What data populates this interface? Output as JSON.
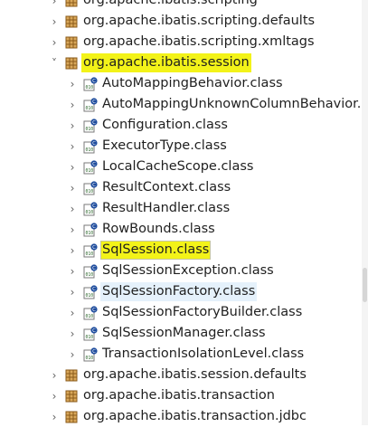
{
  "packages_before": [
    {
      "label": "org.apache.ibatis.scripting"
    },
    {
      "label": "org.apache.ibatis.scripting.defaults"
    },
    {
      "label": "org.apache.ibatis.scripting.xmltags"
    }
  ],
  "expanded_package": {
    "label": "org.apache.ibatis.session",
    "expander": "˅"
  },
  "classes": [
    {
      "label": "AutoMappingBehavior.class"
    },
    {
      "label": "AutoMappingUnknownColumnBehavior.cl"
    },
    {
      "label": "Configuration.class"
    },
    {
      "label": "ExecutorType.class"
    },
    {
      "label": "LocalCacheScope.class"
    },
    {
      "label": "ResultContext.class"
    },
    {
      "label": "ResultHandler.class"
    },
    {
      "label": "RowBounds.class"
    },
    {
      "label": "SqlSession.class"
    },
    {
      "label": "SqlSessionException.class"
    },
    {
      "label": "SqlSessionFactory.class"
    },
    {
      "label": "SqlSessionFactoryBuilder.class"
    },
    {
      "label": "SqlSessionManager.class"
    },
    {
      "label": "TransactionIsolationLevel.class"
    }
  ],
  "packages_after": [
    {
      "label": "org.apache.ibatis.session.defaults"
    },
    {
      "label": "org.apache.ibatis.transaction"
    },
    {
      "label": "org.apache.ibatis.transaction.jdbc"
    }
  ],
  "collapsed_expander": "›",
  "colors": {
    "highlight": "#f3f319",
    "package_icon": "#b07a2c",
    "class_badge": "#1f4d9e",
    "binary_text": "#2f6b2f"
  }
}
